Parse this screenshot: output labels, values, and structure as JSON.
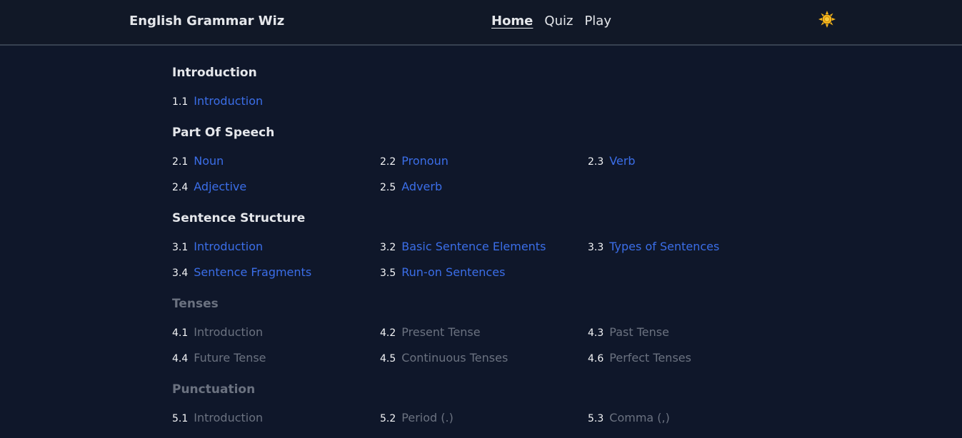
{
  "header": {
    "app_title": "English Grammar Wiz",
    "nav": [
      {
        "label": "Home",
        "active": true
      },
      {
        "label": "Quiz",
        "active": false
      },
      {
        "label": "Play",
        "active": false
      }
    ],
    "theme_icon": "sun-icon",
    "theme_icon_color": "#f5b41a"
  },
  "colors": {
    "background": "#0f172a",
    "header_background": "#111827",
    "link_active": "#3b6ee8",
    "link_disabled": "#6b7280",
    "text": "#e5e7eb"
  },
  "sections": [
    {
      "title": "Introduction",
      "enabled": true,
      "topics": [
        {
          "number": "1.1",
          "label": "Introduction"
        }
      ]
    },
    {
      "title": "Part Of Speech",
      "enabled": true,
      "topics": [
        {
          "number": "2.1",
          "label": "Noun"
        },
        {
          "number": "2.2",
          "label": "Pronoun"
        },
        {
          "number": "2.3",
          "label": "Verb"
        },
        {
          "number": "2.4",
          "label": "Adjective"
        },
        {
          "number": "2.5",
          "label": "Adverb"
        }
      ]
    },
    {
      "title": "Sentence Structure",
      "enabled": true,
      "topics": [
        {
          "number": "3.1",
          "label": "Introduction"
        },
        {
          "number": "3.2",
          "label": "Basic Sentence Elements"
        },
        {
          "number": "3.3",
          "label": "Types of Sentences"
        },
        {
          "number": "3.4",
          "label": "Sentence Fragments"
        },
        {
          "number": "3.5",
          "label": "Run-on Sentences"
        }
      ]
    },
    {
      "title": "Tenses",
      "enabled": false,
      "topics": [
        {
          "number": "4.1",
          "label": "Introduction"
        },
        {
          "number": "4.2",
          "label": "Present Tense"
        },
        {
          "number": "4.3",
          "label": "Past Tense"
        },
        {
          "number": "4.4",
          "label": "Future Tense"
        },
        {
          "number": "4.5",
          "label": "Continuous Tenses"
        },
        {
          "number": "4.6",
          "label": "Perfect Tenses"
        }
      ]
    },
    {
      "title": "Punctuation",
      "enabled": false,
      "topics": [
        {
          "number": "5.1",
          "label": "Introduction"
        },
        {
          "number": "5.2",
          "label": "Period (.)"
        },
        {
          "number": "5.3",
          "label": "Comma (,)"
        }
      ]
    }
  ]
}
